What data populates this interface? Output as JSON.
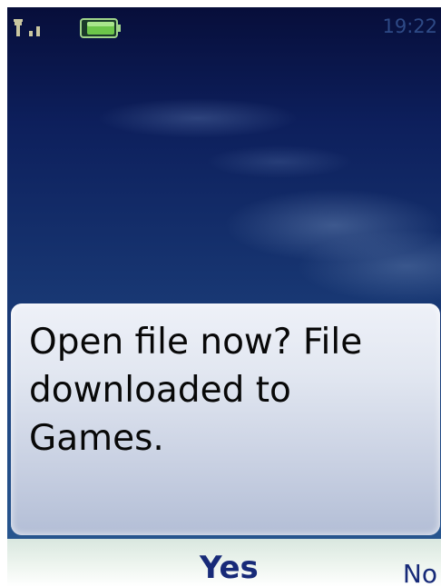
{
  "status_bar": {
    "signal_icon": "signal-strength-icon",
    "battery_icon": "battery-icon",
    "time": "19:22"
  },
  "dialog": {
    "message": "Open file now? File downloaded to Games."
  },
  "softkeys": {
    "yes_label": "Yes",
    "no_label": "No"
  },
  "colors": {
    "wallpaper_top": "#070e3a",
    "wallpaper_bottom": "#2a5b93",
    "dialog_bg": "#e2e7f1",
    "softkey_text": "#172a78",
    "battery_fill": "#6cc64a",
    "clock_text": "#2e4a86"
  }
}
